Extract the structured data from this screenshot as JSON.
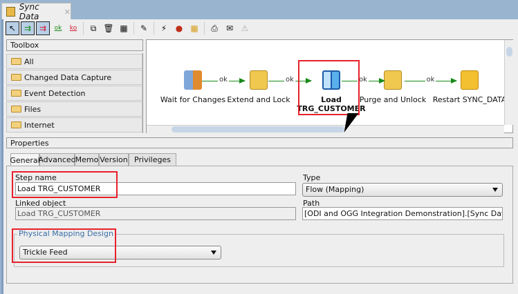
{
  "window": {
    "tab_title": "Sync Data"
  },
  "toolbox": {
    "title": "Toolbox",
    "items": [
      "All",
      "Changed Data Capture",
      "Event Detection",
      "Files",
      "Internet"
    ]
  },
  "diagram": {
    "steps": [
      {
        "label": "Wait for Changes"
      },
      {
        "label": "Extend and Lock"
      },
      {
        "label": "Load",
        "label2": "TRG_CUSTOMER"
      },
      {
        "label": "Purge and Unlock"
      },
      {
        "label": "Restart SYNC_DATA"
      }
    ],
    "link_label": "ok"
  },
  "toolbar": {
    "ok_label": "ok",
    "ko_label": "ko"
  },
  "properties": {
    "title": "Properties",
    "tabs": [
      "General",
      "Advanced",
      "Memo",
      "Version",
      "Privileges"
    ],
    "step_name_label": "Step name",
    "step_name_value": "Load TRG_CUSTOMER",
    "type_label": "Type",
    "type_value": "Flow (Mapping)",
    "linked_label": "Linked object",
    "linked_value": "Load TRG_CUSTOMER",
    "path_label": "Path",
    "path_value": "[ODI and OGG Integration Demonstration].[Sync Data]",
    "pmd_label": "Physical Mapping Design",
    "pmd_value": "Trickle Feed"
  },
  "colors": {
    "highlight": "#e8202a",
    "link": "#1a8a1a",
    "group_title": "#3a6ea5"
  }
}
